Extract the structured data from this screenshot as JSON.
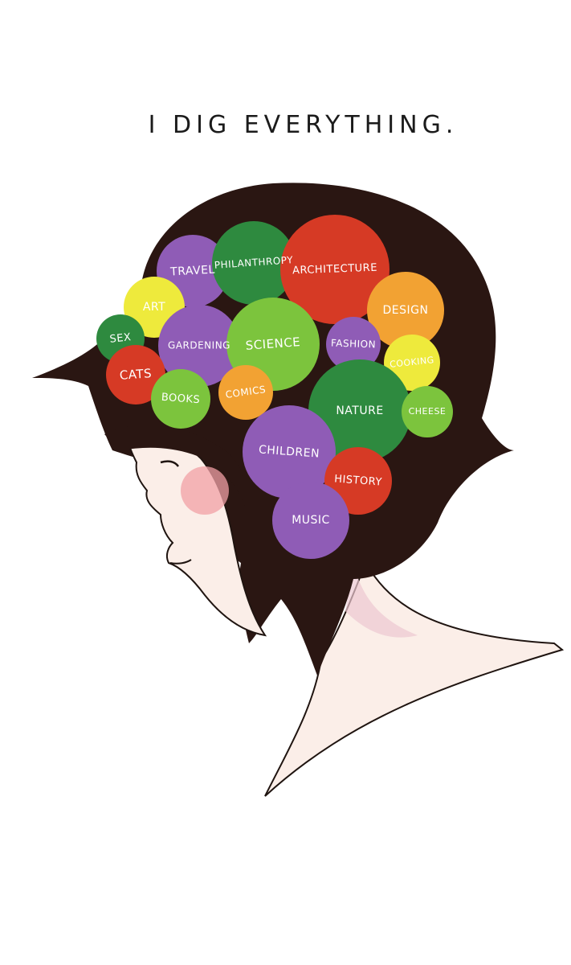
{
  "title": "I DIG EVERYTHING.",
  "colors": {
    "hair": "#2a1612",
    "skin": "#fbeee8",
    "blush": "#f2a0a6",
    "green": "#2e8a3f",
    "light_green": "#7cc43d",
    "purple": "#8f5cb6",
    "red": "#d63a25",
    "orange": "#f2a233",
    "yellow": "#eeea3c"
  },
  "bubbles": [
    {
      "label": "TRAVEL",
      "color": "purple"
    },
    {
      "label": "PHILANTHROPY",
      "color": "green"
    },
    {
      "label": "ARCHITECTURE",
      "color": "red"
    },
    {
      "label": "ART",
      "color": "yellow"
    },
    {
      "label": "DESIGN",
      "color": "orange"
    },
    {
      "label": "SEX",
      "color": "green"
    },
    {
      "label": "GARDENING",
      "color": "purple"
    },
    {
      "label": "SCIENCE",
      "color": "light_green"
    },
    {
      "label": "FASHION",
      "color": "purple"
    },
    {
      "label": "COOKING",
      "color": "yellow"
    },
    {
      "label": "CATS",
      "color": "red"
    },
    {
      "label": "COMICS",
      "color": "orange"
    },
    {
      "label": "BOOKS",
      "color": "light_green"
    },
    {
      "label": "NATURE",
      "color": "green"
    },
    {
      "label": "CHEESE",
      "color": "light_green"
    },
    {
      "label": "CHILDREN",
      "color": "purple"
    },
    {
      "label": "HISTORY",
      "color": "red"
    },
    {
      "label": "MUSIC",
      "color": "purple"
    }
  ]
}
